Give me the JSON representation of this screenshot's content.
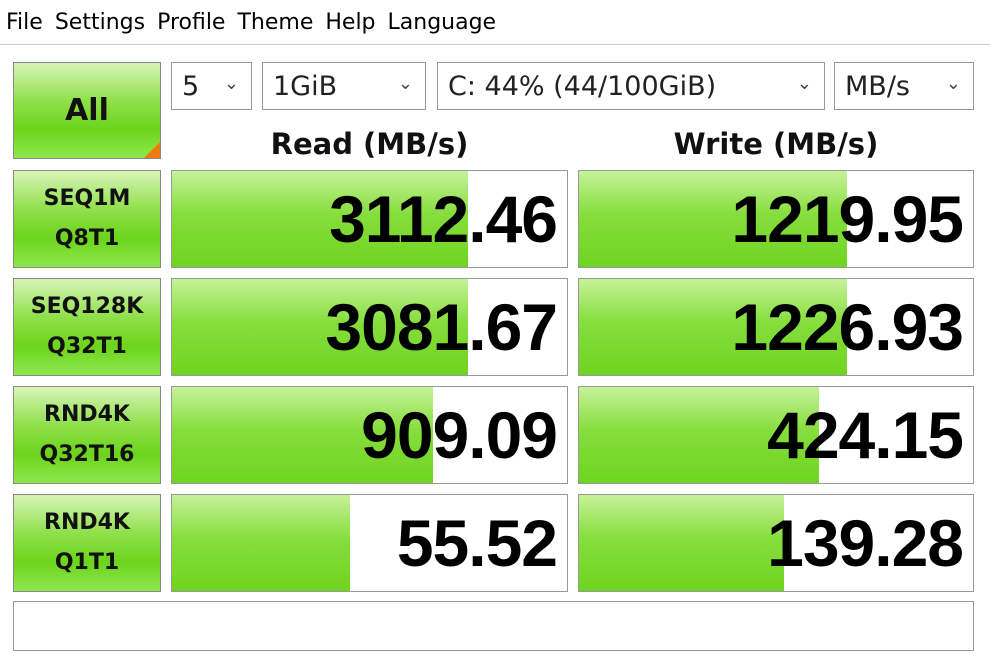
{
  "menu": [
    "File",
    "Settings",
    "Profile",
    "Theme",
    "Help",
    "Language"
  ],
  "controls": {
    "all_label": "All",
    "count": "5",
    "size": "1GiB",
    "drive": "C: 44% (44/100GiB)",
    "unit": "MB/s"
  },
  "headers": {
    "read": "Read (MB/s)",
    "write": "Write (MB/s)"
  },
  "rows": [
    {
      "label1": "SEQ1M",
      "label2": "Q8T1",
      "read": "3112.46",
      "write": "1219.95",
      "read_fill": 0.75,
      "write_fill": 0.68
    },
    {
      "label1": "SEQ128K",
      "label2": "Q32T1",
      "read": "3081.67",
      "write": "1226.93",
      "read_fill": 0.75,
      "write_fill": 0.68
    },
    {
      "label1": "RND4K",
      "label2": "Q32T16",
      "read": "909.09",
      "write": "424.15",
      "read_fill": 0.66,
      "write_fill": 0.61
    },
    {
      "label1": "RND4K",
      "label2": "Q1T1",
      "read": "55.52",
      "write": "139.28",
      "read_fill": 0.45,
      "write_fill": 0.52
    }
  ],
  "comment": ""
}
